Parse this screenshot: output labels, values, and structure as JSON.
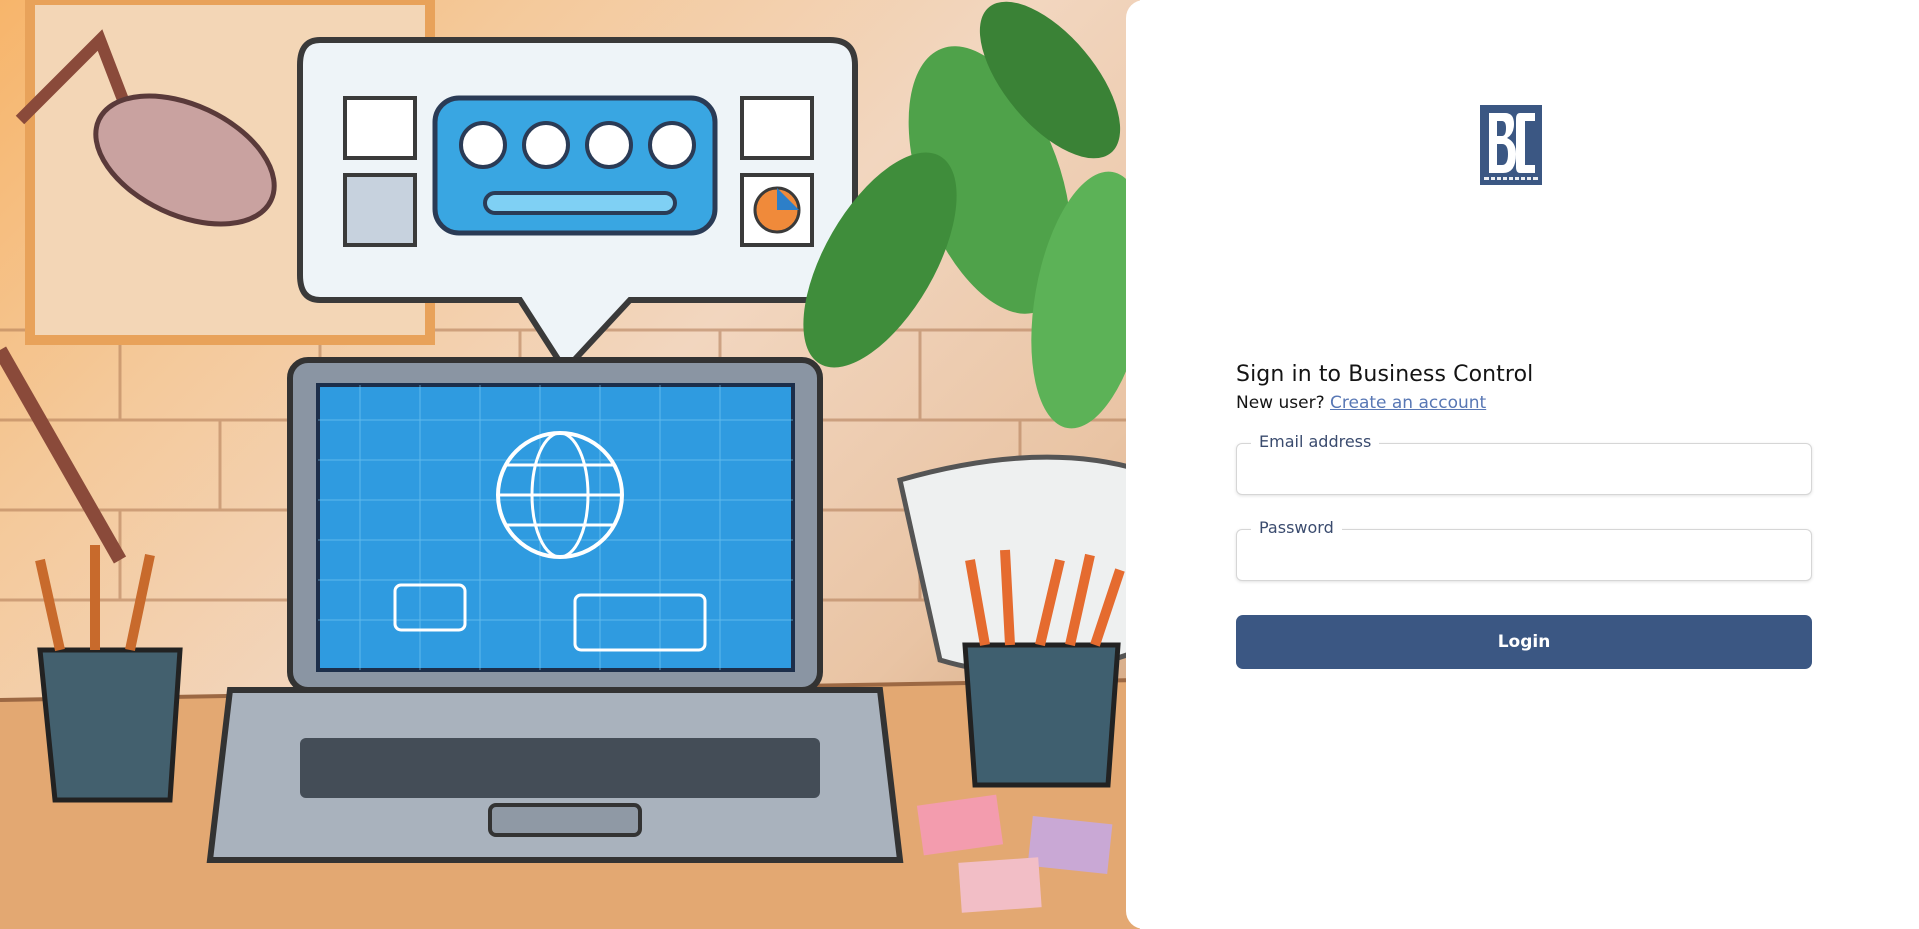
{
  "logo": {
    "alt": "BC logo",
    "letters": "BC",
    "color": "#3b5783"
  },
  "signin": {
    "title": "Sign in to Business Control",
    "new_user_prefix": "New user?",
    "create_account_link": "Create an account"
  },
  "form": {
    "email_label": "Email address",
    "email_value": "",
    "password_label": "Password",
    "password_value": "",
    "login_button": "Login"
  },
  "colors": {
    "primary": "#3b5783",
    "link": "#5877b4"
  },
  "illustration": {
    "description_icons": [
      "desk-lamp-icon",
      "laptop-icon",
      "speech-bubble-icon",
      "plant-icon",
      "pencil-cup-icon",
      "globe-icon"
    ]
  }
}
